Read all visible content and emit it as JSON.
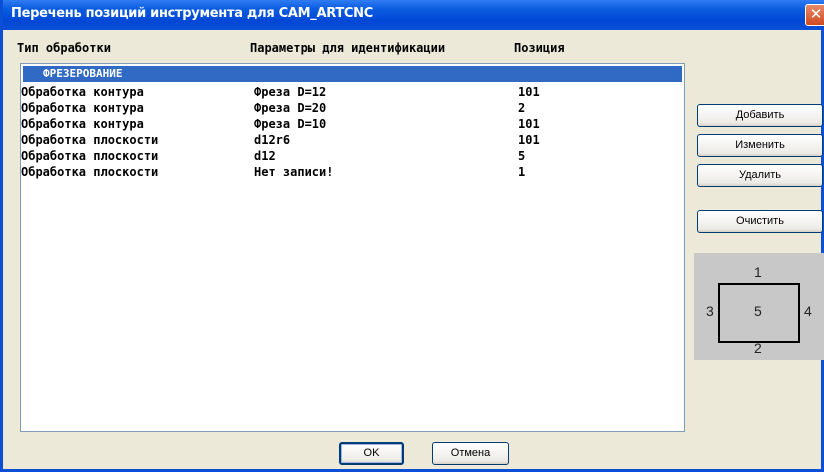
{
  "window": {
    "title": "Перечень позиций инструмента для CAM_ARTCNC",
    "close_glyph": "✕"
  },
  "columns": {
    "type": "Тип обработки",
    "params": "Параметры для идентификации",
    "position": "Позиция"
  },
  "list": {
    "group_label": "ФРЕЗЕРОВАНИЕ",
    "rows": [
      {
        "type": "Обработка контура",
        "params": "Фреза D=12",
        "position": "101"
      },
      {
        "type": "Обработка контура",
        "params": "Фреза D=20",
        "position": "2"
      },
      {
        "type": "Обработка контура",
        "params": "Фреза D=10",
        "position": "101"
      },
      {
        "type": "Обработка плоскости",
        "params": "d12r6",
        "position": "101"
      },
      {
        "type": "Обработка плоскости",
        "params": "d12",
        "position": "5"
      },
      {
        "type": "Обработка плоскости",
        "params": "Нет записи!",
        "position": "1"
      }
    ]
  },
  "buttons": {
    "add": "Добавить",
    "edit": "Изменить",
    "delete": "Удалить",
    "clear": "Очистить",
    "ok": "OK",
    "cancel": "Отмена"
  },
  "diagram": {
    "top": "1",
    "bottom": "2",
    "left": "3",
    "right": "4",
    "center": "5"
  },
  "colors": {
    "titlebar": "#0a4fd6",
    "selection": "#316ac5",
    "dialog_bg": "#ece9d8"
  }
}
